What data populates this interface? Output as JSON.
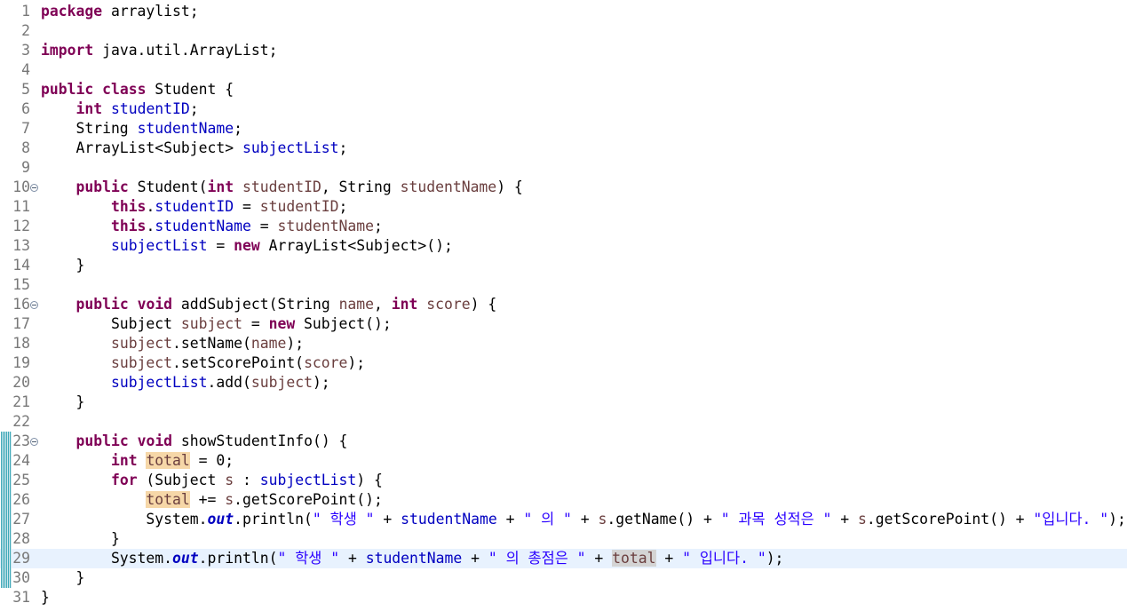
{
  "editor": {
    "lines": [
      {
        "n": "1",
        "tokens": [
          {
            "t": "package",
            "c": "kw"
          },
          {
            "t": " arraylist;",
            "c": "txt"
          }
        ]
      },
      {
        "n": "2",
        "tokens": []
      },
      {
        "n": "3",
        "tokens": [
          {
            "t": "import",
            "c": "kw"
          },
          {
            "t": " java.util.ArrayList;",
            "c": "txt"
          }
        ]
      },
      {
        "n": "4",
        "tokens": []
      },
      {
        "n": "5",
        "tokens": [
          {
            "t": "public",
            "c": "kw"
          },
          {
            "t": " ",
            "c": "txt"
          },
          {
            "t": "class",
            "c": "kw"
          },
          {
            "t": " Student {",
            "c": "txt"
          }
        ]
      },
      {
        "n": "6",
        "tokens": [
          {
            "t": "    ",
            "c": "txt"
          },
          {
            "t": "int",
            "c": "kw"
          },
          {
            "t": " ",
            "c": "txt"
          },
          {
            "t": "studentID",
            "c": "fld"
          },
          {
            "t": ";",
            "c": "txt"
          }
        ]
      },
      {
        "n": "7",
        "tokens": [
          {
            "t": "    String ",
            "c": "txt"
          },
          {
            "t": "studentName",
            "c": "fld"
          },
          {
            "t": ";",
            "c": "txt"
          }
        ]
      },
      {
        "n": "8",
        "tokens": [
          {
            "t": "    ArrayList<Subject> ",
            "c": "txt"
          },
          {
            "t": "subjectList",
            "c": "fld"
          },
          {
            "t": ";",
            "c": "txt"
          }
        ]
      },
      {
        "n": "9",
        "tokens": []
      },
      {
        "n": "10",
        "fold": true,
        "tokens": [
          {
            "t": "    ",
            "c": "txt"
          },
          {
            "t": "public",
            "c": "kw"
          },
          {
            "t": " Student(",
            "c": "txt"
          },
          {
            "t": "int",
            "c": "kw"
          },
          {
            "t": " ",
            "c": "txt"
          },
          {
            "t": "studentID",
            "c": "prm"
          },
          {
            "t": ", String ",
            "c": "txt"
          },
          {
            "t": "studentName",
            "c": "prm"
          },
          {
            "t": ") {",
            "c": "txt"
          }
        ]
      },
      {
        "n": "11",
        "tokens": [
          {
            "t": "        ",
            "c": "txt"
          },
          {
            "t": "this",
            "c": "kw"
          },
          {
            "t": ".",
            "c": "txt"
          },
          {
            "t": "studentID",
            "c": "fld"
          },
          {
            "t": " = ",
            "c": "txt"
          },
          {
            "t": "studentID",
            "c": "prm"
          },
          {
            "t": ";",
            "c": "txt"
          }
        ]
      },
      {
        "n": "12",
        "tokens": [
          {
            "t": "        ",
            "c": "txt"
          },
          {
            "t": "this",
            "c": "kw"
          },
          {
            "t": ".",
            "c": "txt"
          },
          {
            "t": "studentName",
            "c": "fld"
          },
          {
            "t": " = ",
            "c": "txt"
          },
          {
            "t": "studentName",
            "c": "prm"
          },
          {
            "t": ";",
            "c": "txt"
          }
        ]
      },
      {
        "n": "13",
        "tokens": [
          {
            "t": "        ",
            "c": "txt"
          },
          {
            "t": "subjectList",
            "c": "fld"
          },
          {
            "t": " = ",
            "c": "txt"
          },
          {
            "t": "new",
            "c": "kw"
          },
          {
            "t": " ArrayList<Subject>();",
            "c": "txt"
          }
        ]
      },
      {
        "n": "14",
        "tokens": [
          {
            "t": "    }",
            "c": "txt"
          }
        ]
      },
      {
        "n": "15",
        "tokens": []
      },
      {
        "n": "16",
        "fold": true,
        "tokens": [
          {
            "t": "    ",
            "c": "txt"
          },
          {
            "t": "public",
            "c": "kw"
          },
          {
            "t": " ",
            "c": "txt"
          },
          {
            "t": "void",
            "c": "kw"
          },
          {
            "t": " addSubject(String ",
            "c": "txt"
          },
          {
            "t": "name",
            "c": "prm"
          },
          {
            "t": ", ",
            "c": "txt"
          },
          {
            "t": "int",
            "c": "kw"
          },
          {
            "t": " ",
            "c": "txt"
          },
          {
            "t": "score",
            "c": "prm"
          },
          {
            "t": ") {",
            "c": "txt"
          }
        ]
      },
      {
        "n": "17",
        "tokens": [
          {
            "t": "        Subject ",
            "c": "txt"
          },
          {
            "t": "subject",
            "c": "lcl"
          },
          {
            "t": " = ",
            "c": "txt"
          },
          {
            "t": "new",
            "c": "kw"
          },
          {
            "t": " Subject();",
            "c": "txt"
          }
        ]
      },
      {
        "n": "18",
        "tokens": [
          {
            "t": "        ",
            "c": "txt"
          },
          {
            "t": "subject",
            "c": "lcl"
          },
          {
            "t": ".setName(",
            "c": "txt"
          },
          {
            "t": "name",
            "c": "prm"
          },
          {
            "t": ");",
            "c": "txt"
          }
        ]
      },
      {
        "n": "19",
        "tokens": [
          {
            "t": "        ",
            "c": "txt"
          },
          {
            "t": "subject",
            "c": "lcl"
          },
          {
            "t": ".setScorePoint(",
            "c": "txt"
          },
          {
            "t": "score",
            "c": "prm"
          },
          {
            "t": ");",
            "c": "txt"
          }
        ]
      },
      {
        "n": "20",
        "tokens": [
          {
            "t": "        ",
            "c": "txt"
          },
          {
            "t": "subjectList",
            "c": "fld"
          },
          {
            "t": ".add(",
            "c": "txt"
          },
          {
            "t": "subject",
            "c": "lcl"
          },
          {
            "t": ");",
            "c": "txt"
          }
        ]
      },
      {
        "n": "21",
        "tokens": [
          {
            "t": "    }",
            "c": "txt"
          }
        ]
      },
      {
        "n": "22",
        "tokens": []
      },
      {
        "n": "23",
        "fold": true,
        "changed": true,
        "tokens": [
          {
            "t": "    ",
            "c": "txt"
          },
          {
            "t": "public",
            "c": "kw"
          },
          {
            "t": " ",
            "c": "txt"
          },
          {
            "t": "void",
            "c": "kw"
          },
          {
            "t": " showStudentInfo() {",
            "c": "txt"
          }
        ]
      },
      {
        "n": "24",
        "changed": true,
        "tokens": [
          {
            "t": "        ",
            "c": "txt"
          },
          {
            "t": "int",
            "c": "kw"
          },
          {
            "t": " ",
            "c": "txt"
          },
          {
            "t": "total",
            "c": "lcl-hl"
          },
          {
            "t": " = 0;",
            "c": "txt"
          }
        ]
      },
      {
        "n": "25",
        "changed": true,
        "tokens": [
          {
            "t": "        ",
            "c": "txt"
          },
          {
            "t": "for",
            "c": "kw"
          },
          {
            "t": " (Subject ",
            "c": "txt"
          },
          {
            "t": "s",
            "c": "lcl"
          },
          {
            "t": " : ",
            "c": "txt"
          },
          {
            "t": "subjectList",
            "c": "fld"
          },
          {
            "t": ") {",
            "c": "txt"
          }
        ]
      },
      {
        "n": "26",
        "changed": true,
        "tokens": [
          {
            "t": "            ",
            "c": "txt"
          },
          {
            "t": "total",
            "c": "lcl-hl"
          },
          {
            "t": " += ",
            "c": "txt"
          },
          {
            "t": "s",
            "c": "lcl"
          },
          {
            "t": ".getScorePoint();",
            "c": "txt"
          }
        ]
      },
      {
        "n": "27",
        "changed": true,
        "tokens": [
          {
            "t": "            System.",
            "c": "txt"
          },
          {
            "t": "out",
            "c": "st"
          },
          {
            "t": ".println(",
            "c": "txt"
          },
          {
            "t": "\" 학생 \"",
            "c": "str"
          },
          {
            "t": " + ",
            "c": "txt"
          },
          {
            "t": "studentName",
            "c": "fld"
          },
          {
            "t": " + ",
            "c": "txt"
          },
          {
            "t": "\" 의 \"",
            "c": "str"
          },
          {
            "t": " + ",
            "c": "txt"
          },
          {
            "t": "s",
            "c": "lcl"
          },
          {
            "t": ".getName() + ",
            "c": "txt"
          },
          {
            "t": "\" 과목 성적은 \"",
            "c": "str"
          },
          {
            "t": " + ",
            "c": "txt"
          },
          {
            "t": "s",
            "c": "lcl"
          },
          {
            "t": ".getScorePoint() + ",
            "c": "txt"
          },
          {
            "t": "\"입니다. \"",
            "c": "str"
          },
          {
            "t": ");",
            "c": "txt"
          }
        ]
      },
      {
        "n": "28",
        "changed": true,
        "tokens": [
          {
            "t": "        }",
            "c": "txt"
          }
        ]
      },
      {
        "n": "29",
        "changed": true,
        "current": true,
        "tokens": [
          {
            "t": "        System.",
            "c": "txt"
          },
          {
            "t": "out",
            "c": "st"
          },
          {
            "t": ".println(",
            "c": "txt"
          },
          {
            "t": "\" 학생 \"",
            "c": "str"
          },
          {
            "t": " + ",
            "c": "txt"
          },
          {
            "t": "studentName",
            "c": "fld"
          },
          {
            "t": " + ",
            "c": "txt"
          },
          {
            "t": "\" 의 총점은 \"",
            "c": "str"
          },
          {
            "t": " + ",
            "c": "txt"
          },
          {
            "t": "total",
            "c": "lcl-hl2"
          },
          {
            "t": " + ",
            "c": "txt"
          },
          {
            "t": "\" 입니다. \"",
            "c": "str"
          },
          {
            "t": ");",
            "c": "txt"
          }
        ]
      },
      {
        "n": "30",
        "changed": true,
        "tokens": [
          {
            "t": "    }",
            "c": "txt"
          }
        ]
      },
      {
        "n": "31",
        "tokens": [
          {
            "t": "}",
            "c": "txt"
          }
        ]
      }
    ]
  }
}
